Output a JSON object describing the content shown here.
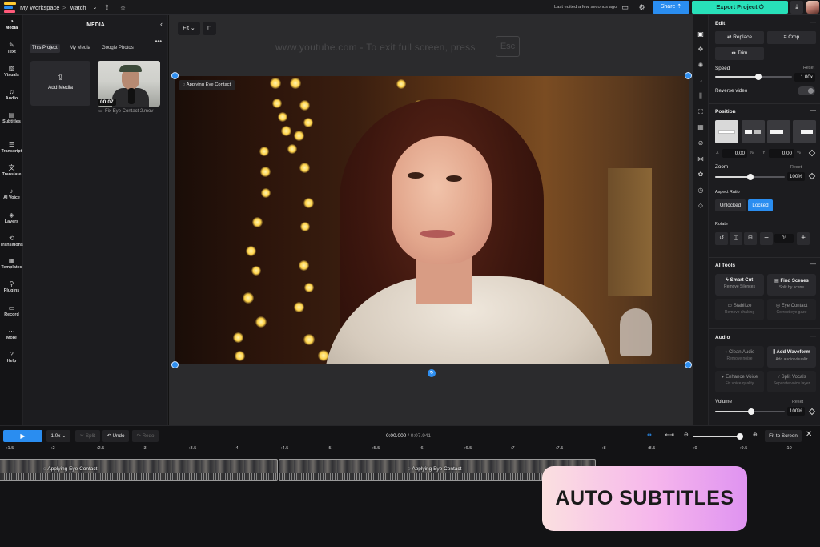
{
  "topbar": {
    "workspace": "My Workspace",
    "separator": ">",
    "project": "watch",
    "edited": "Last edited a few seconds ago",
    "share_label": "Share",
    "export_label": "Export Project"
  },
  "leftnav": {
    "items": [
      {
        "label": "Media"
      },
      {
        "label": "Text"
      },
      {
        "label": "Visuals"
      },
      {
        "label": "Audio"
      },
      {
        "label": "Subtitles"
      },
      {
        "label": "Transcript"
      },
      {
        "label": "Translate"
      },
      {
        "label": "AI Voice"
      },
      {
        "label": "Layers"
      },
      {
        "label": "Transitions"
      },
      {
        "label": "Templates"
      },
      {
        "label": "Plugins"
      },
      {
        "label": "Record"
      },
      {
        "label": "More"
      },
      {
        "label": "Help"
      }
    ]
  },
  "media": {
    "title": "MEDIA",
    "tabs": [
      "This Project",
      "My Media",
      "Google Photos"
    ],
    "add_label": "Add Media",
    "clip_duration": "00:07",
    "clip_name": "Fix Eye Contact 2.mov"
  },
  "canvas": {
    "fit_label": "Fit",
    "overlay_text": "www.youtube.com  -  To exit full screen, press",
    "overlay_key": "Esc",
    "badge": "Applying Eye Contact"
  },
  "props": {
    "edit": {
      "title": "Edit",
      "replace": "Replace",
      "crop": "Crop",
      "trim": "Trim",
      "speed_label": "Speed",
      "reset": "Reset",
      "speed_value": "1.00",
      "speed_unit": "x",
      "reverse_label": "Reverse video"
    },
    "position": {
      "title": "Position",
      "x_label": "X",
      "x_value": "0.00",
      "y_label": "Y",
      "y_value": "0.00",
      "unit": "%",
      "zoom_label": "Zoom",
      "zoom_value": "100%",
      "aspect_label": "Aspect Ratio",
      "unlocked": "Unlocked",
      "locked": "Locked",
      "rotate_label": "Rotate",
      "rotate_value": "0°"
    },
    "ai_tools": {
      "title": "AI Tools",
      "cards": [
        {
          "title": "Smart Cut",
          "sub": "Remove Silences"
        },
        {
          "title": "Find Scenes",
          "sub": "Split by scene"
        },
        {
          "title": "Stabilize",
          "sub": "Remove shaking"
        },
        {
          "title": "Eye Contact",
          "sub": "Correct eye gaze"
        }
      ]
    },
    "audio": {
      "title": "Audio",
      "cards": [
        {
          "title": "Clean Audio",
          "sub": "Remove noise"
        },
        {
          "title": "Add Waveform",
          "sub": "Add audio visualiz"
        },
        {
          "title": "Enhance Voice",
          "sub": "Fix voice quality"
        },
        {
          "title": "Split Vocals",
          "sub": "Separate voice layer"
        }
      ],
      "volume_label": "Volume",
      "volume_value": "100%"
    }
  },
  "timeline": {
    "speed": "1.0x",
    "split": "Split",
    "undo": "Undo",
    "redo": "Redo",
    "current_time": "0:00.000",
    "total_time": "/ 0:07.941",
    "fit_screen": "Fit to Screen",
    "ruler": [
      ":1.5",
      ":2",
      ":2.5",
      ":3",
      ":3.5",
      ":4",
      ":4.5",
      ":5",
      ":5.5",
      ":6",
      ":6.5",
      ":7",
      ":7.5",
      ":8",
      ":8.5",
      ":9",
      ":9.5",
      ":10"
    ],
    "clips": [
      {
        "label": "Applying Eye Contact"
      },
      {
        "label": "Applying Eye Contact"
      }
    ]
  },
  "cta": "AUTO SUBTITLES",
  "colors": {
    "accent": "#2a8df0",
    "export": "#28e0b9"
  }
}
